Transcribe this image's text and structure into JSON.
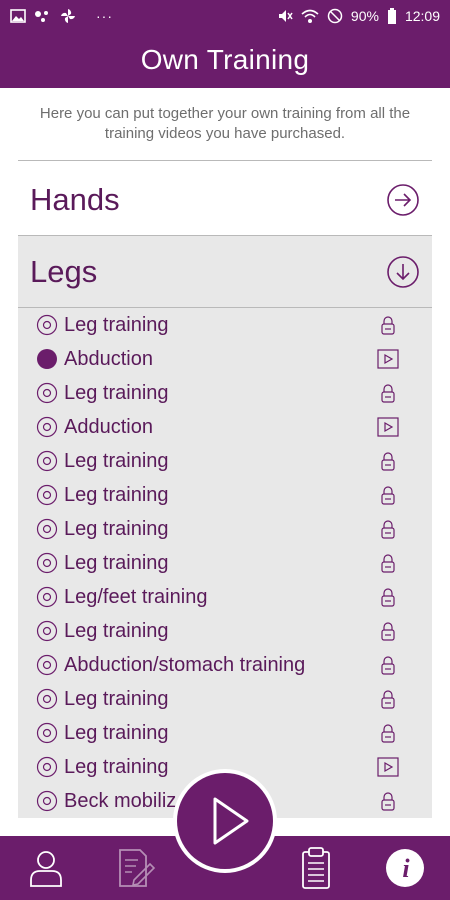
{
  "statusbar": {
    "left_icons": [
      "image-icon",
      "signal-dots-icon",
      "fan-icon",
      "more-dots-icon"
    ],
    "right_icons": [
      "mute-icon",
      "wifi-icon",
      "block-icon"
    ],
    "battery": "90%",
    "time": "12:09",
    "ellipsis": "···"
  },
  "header": {
    "title": "Own Training"
  },
  "description": "Here you can put together your own training from all the training videos you have purchased.",
  "categories": [
    {
      "label": "Hands",
      "icon": "arrow-right-circle-icon",
      "expanded": false
    },
    {
      "label": "Legs",
      "icon": "arrow-down-circle-icon",
      "expanded": true
    }
  ],
  "legs_items": [
    {
      "label": "Leg training",
      "selected": false,
      "icon": "lock-icon"
    },
    {
      "label": "Abduction",
      "selected": true,
      "icon": "play-video-icon"
    },
    {
      "label": "Leg training",
      "selected": false,
      "icon": "lock-icon"
    },
    {
      "label": "Adduction",
      "selected": false,
      "icon": "play-video-icon"
    },
    {
      "label": "Leg training",
      "selected": false,
      "icon": "lock-icon"
    },
    {
      "label": "Leg training",
      "selected": false,
      "icon": "lock-icon"
    },
    {
      "label": "Leg training",
      "selected": false,
      "icon": "lock-icon"
    },
    {
      "label": "Leg training",
      "selected": false,
      "icon": "lock-icon"
    },
    {
      "label": "Leg/feet training",
      "selected": false,
      "icon": "lock-icon"
    },
    {
      "label": "Leg training",
      "selected": false,
      "icon": "lock-icon"
    },
    {
      "label": "Abduction/stomach training",
      "selected": false,
      "icon": "lock-icon"
    },
    {
      "label": "Leg training",
      "selected": false,
      "icon": "lock-icon"
    },
    {
      "label": "Leg training",
      "selected": false,
      "icon": "lock-icon"
    },
    {
      "label": "Leg training",
      "selected": false,
      "icon": "play-video-icon"
    },
    {
      "label": "Beck mobiliz",
      "selected": false,
      "icon": "lock-icon"
    }
  ],
  "bottom_nav": [
    "profile-icon",
    "edit-document-icon",
    "play-icon",
    "clipboard-icon",
    "info-icon"
  ],
  "colors": {
    "brand": "#6b1d6b",
    "panel": "#e8e8e8",
    "text": "#5a1a5a"
  }
}
